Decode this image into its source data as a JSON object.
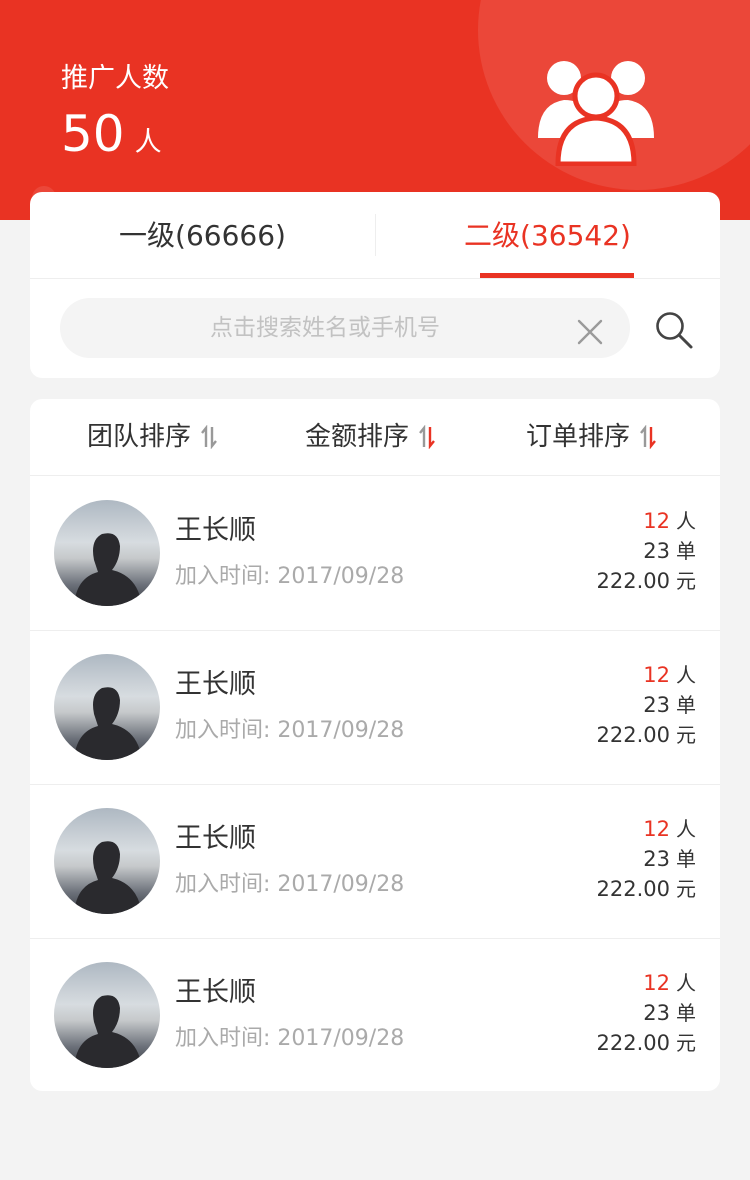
{
  "header": {
    "count_label": "推广人数",
    "count_value": "50",
    "count_unit": "人",
    "icon": "people-group-icon",
    "background_color": "#e93323"
  },
  "tabs": [
    {
      "label": "一级(66666)",
      "active": false
    },
    {
      "label": "二级(36542)",
      "active": true
    }
  ],
  "search": {
    "placeholder": "点击搜索姓名或手机号",
    "clear_icon": "close-icon",
    "submit_icon": "search-icon"
  },
  "sort": [
    {
      "label": "团队排序",
      "icon": "sort-icon"
    },
    {
      "label": "金额排序",
      "icon": "sort-icon"
    },
    {
      "label": "订单排序",
      "icon": "sort-icon"
    }
  ],
  "members": [
    {
      "name": "王长顺",
      "joined": "加入时间: 2017/09/28",
      "people": "12",
      "people_unit": "人",
      "orders": "23",
      "orders_unit": "单",
      "amount": "222.00",
      "amount_unit": "元"
    },
    {
      "name": "王长顺",
      "joined": "加入时间: 2017/09/28",
      "people": "12",
      "people_unit": "人",
      "orders": "23",
      "orders_unit": "单",
      "amount": "222.00",
      "amount_unit": "元"
    },
    {
      "name": "王长顺",
      "joined": "加入时间: 2017/09/28",
      "people": "12",
      "people_unit": "人",
      "orders": "23",
      "orders_unit": "单",
      "amount": "222.00",
      "amount_unit": "元"
    },
    {
      "name": "王长顺",
      "joined": "加入时间: 2017/09/28",
      "people": "12",
      "people_unit": "人",
      "orders": "23",
      "orders_unit": "单",
      "amount": "222.00",
      "amount_unit": "元"
    }
  ],
  "colors": {
    "accent": "#e93323",
    "muted_text": "#aaaaaa",
    "page_bg": "#f3f3f3"
  }
}
